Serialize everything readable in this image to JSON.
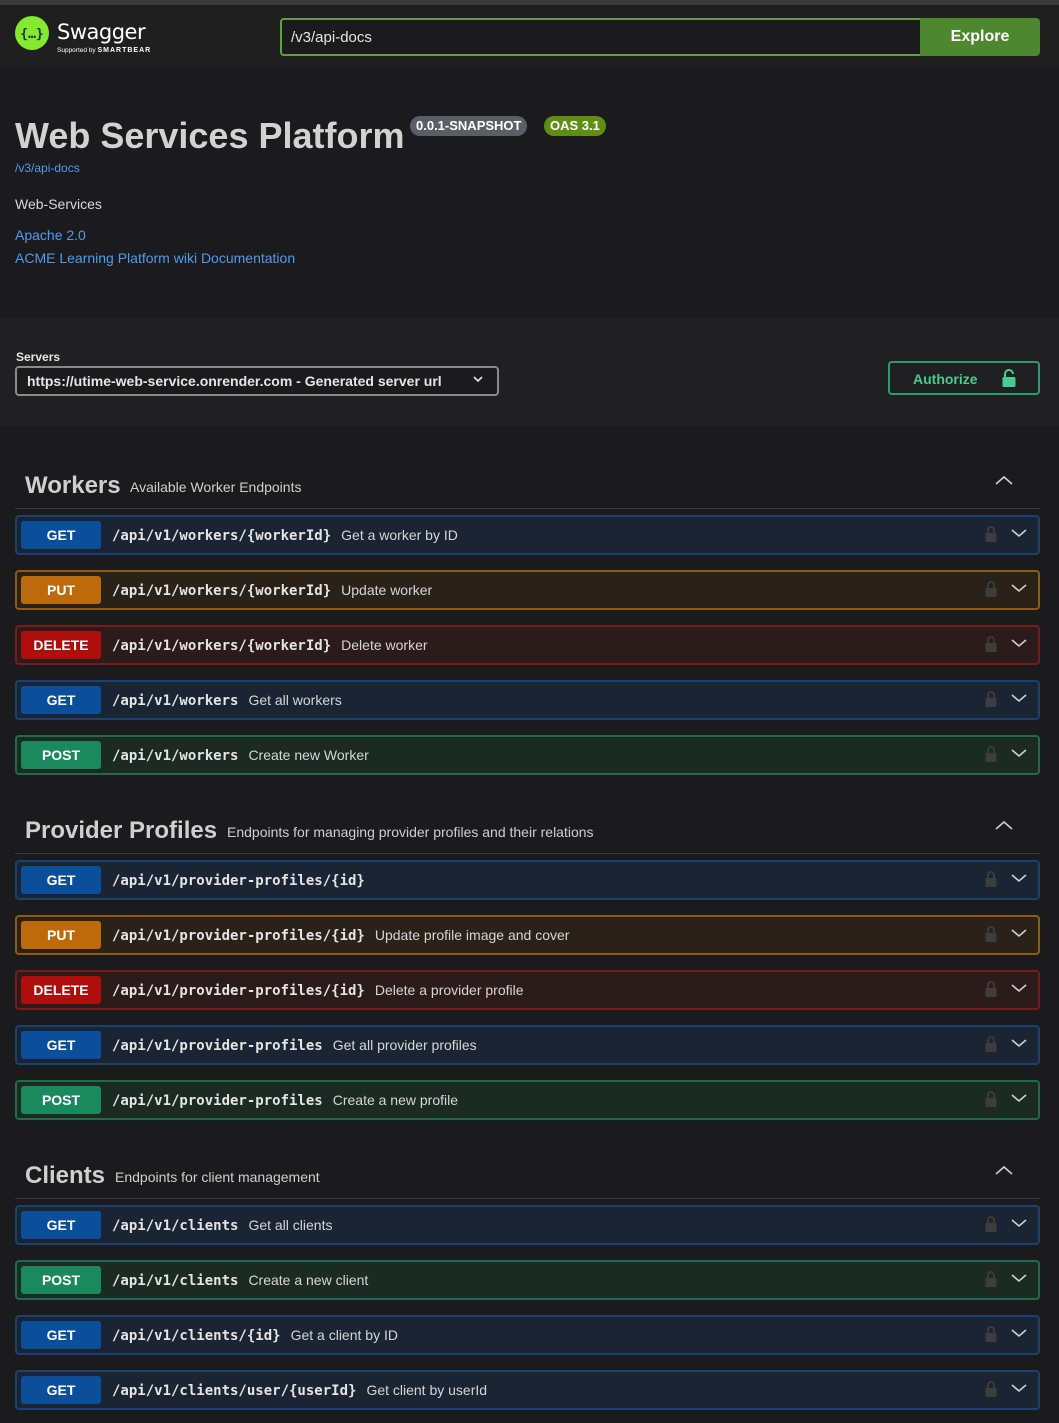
{
  "topbar": {
    "logo_text": "Swagger",
    "logo_sub_prefix": "Supported by",
    "logo_sub_brand": "SMARTBEAR",
    "explore_value": "/v3/api-docs",
    "explore_label": "Explore"
  },
  "info": {
    "title": "Web Services Platform",
    "version": "0.0.1-SNAPSHOT",
    "oas": "OAS 3.1",
    "url": "/v3/api-docs",
    "description": "Web-Services",
    "license": "Apache 2.0",
    "docs": "ACME Learning Platform wiki Documentation"
  },
  "servers": {
    "label": "Servers",
    "selected": "https://utime-web-service.onrender.com - Generated server url",
    "authorize_label": "Authorize"
  },
  "colors": {
    "get": "#0b4f9c",
    "put": "#bd6a0d",
    "delete": "#b00d0d",
    "post": "#1a8a5e",
    "explore": "#4d8830",
    "authorize": "#49cc90"
  },
  "tags": [
    {
      "name": "Workers",
      "description": "Available Worker Endpoints",
      "operations": [
        {
          "method": "GET",
          "path": "/api/v1/workers/{workerId}",
          "summary": "Get a worker by ID"
        },
        {
          "method": "PUT",
          "path": "/api/v1/workers/{workerId}",
          "summary": "Update worker"
        },
        {
          "method": "DELETE",
          "path": "/api/v1/workers/{workerId}",
          "summary": "Delete worker"
        },
        {
          "method": "GET",
          "path": "/api/v1/workers",
          "summary": "Get all workers"
        },
        {
          "method": "POST",
          "path": "/api/v1/workers",
          "summary": "Create new Worker"
        }
      ]
    },
    {
      "name": "Provider Profiles",
      "description": "Endpoints for managing provider profiles and their relations",
      "operations": [
        {
          "method": "GET",
          "path": "/api/v1/provider-profiles/{id}",
          "summary": ""
        },
        {
          "method": "PUT",
          "path": "/api/v1/provider-profiles/{id}",
          "summary": "Update profile image and cover"
        },
        {
          "method": "DELETE",
          "path": "/api/v1/provider-profiles/{id}",
          "summary": "Delete a provider profile"
        },
        {
          "method": "GET",
          "path": "/api/v1/provider-profiles",
          "summary": "Get all provider profiles"
        },
        {
          "method": "POST",
          "path": "/api/v1/provider-profiles",
          "summary": "Create a new profile"
        }
      ]
    },
    {
      "name": "Clients",
      "description": "Endpoints for client management",
      "operations": [
        {
          "method": "GET",
          "path": "/api/v1/clients",
          "summary": "Get all clients"
        },
        {
          "method": "POST",
          "path": "/api/v1/clients",
          "summary": "Create a new client"
        },
        {
          "method": "GET",
          "path": "/api/v1/clients/{id}",
          "summary": "Get a client by ID"
        },
        {
          "method": "GET",
          "path": "/api/v1/clients/user/{userId}",
          "summary": "Get client by userId"
        }
      ]
    }
  ]
}
